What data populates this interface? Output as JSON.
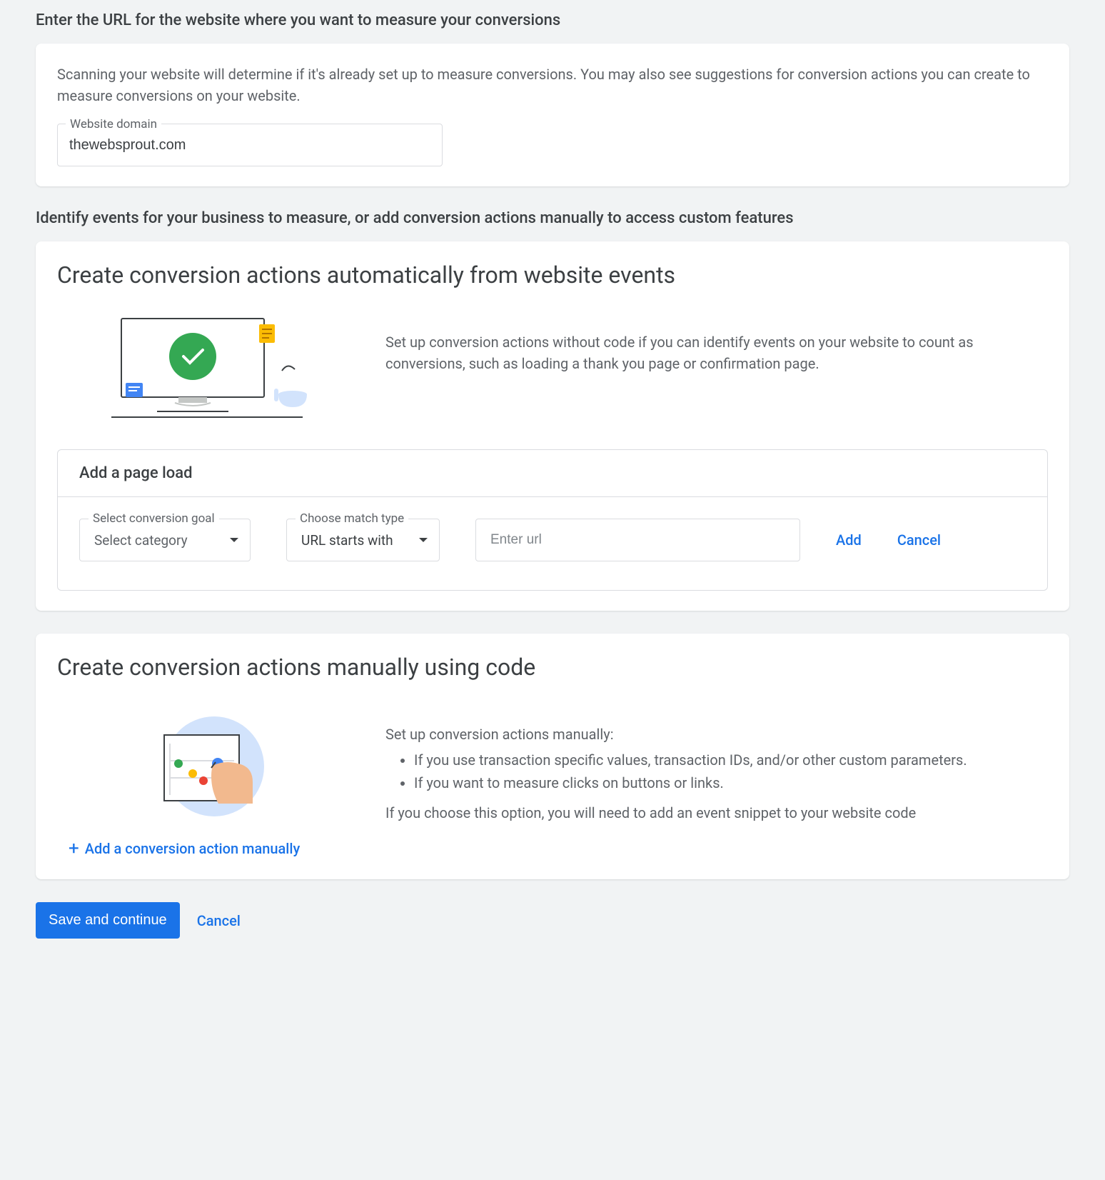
{
  "section1": {
    "header": "Enter the URL for the website where you want to measure your conversions",
    "description": "Scanning your website will determine if it's already set up to measure conversions. You may also see suggestions for conversion actions you can create to measure conversions on your website.",
    "domainLabel": "Website domain",
    "domainValue": "thewebsprout.com"
  },
  "section2Header": "Identify events for your business to measure, or add conversion actions manually to access custom features",
  "autoCard": {
    "title": "Create conversion actions automatically from website events",
    "description": "Set up conversion actions without code if you can identify events on your website to count as conversions, such as loading a thank you page or confirmation page.",
    "pageLoad": {
      "header": "Add a page load",
      "goalLabel": "Select conversion goal",
      "goalPlaceholder": "Select category",
      "matchLabel": "Choose match type",
      "matchValue": "URL starts with",
      "urlPlaceholder": "Enter url",
      "addLabel": "Add",
      "cancelLabel": "Cancel"
    }
  },
  "manualCard": {
    "title": "Create conversion actions manually using code",
    "intro": "Set up conversion actions manually:",
    "bullets": [
      "If you use transaction specific values, transaction IDs, and/or other custom parameters.",
      "If you want to measure clicks on buttons or links."
    ],
    "note": "If you choose this option, you will need to add an event snippet to your website code",
    "addLabel": "Add a conversion action manually"
  },
  "footer": {
    "save": "Save and continue",
    "cancel": "Cancel"
  }
}
